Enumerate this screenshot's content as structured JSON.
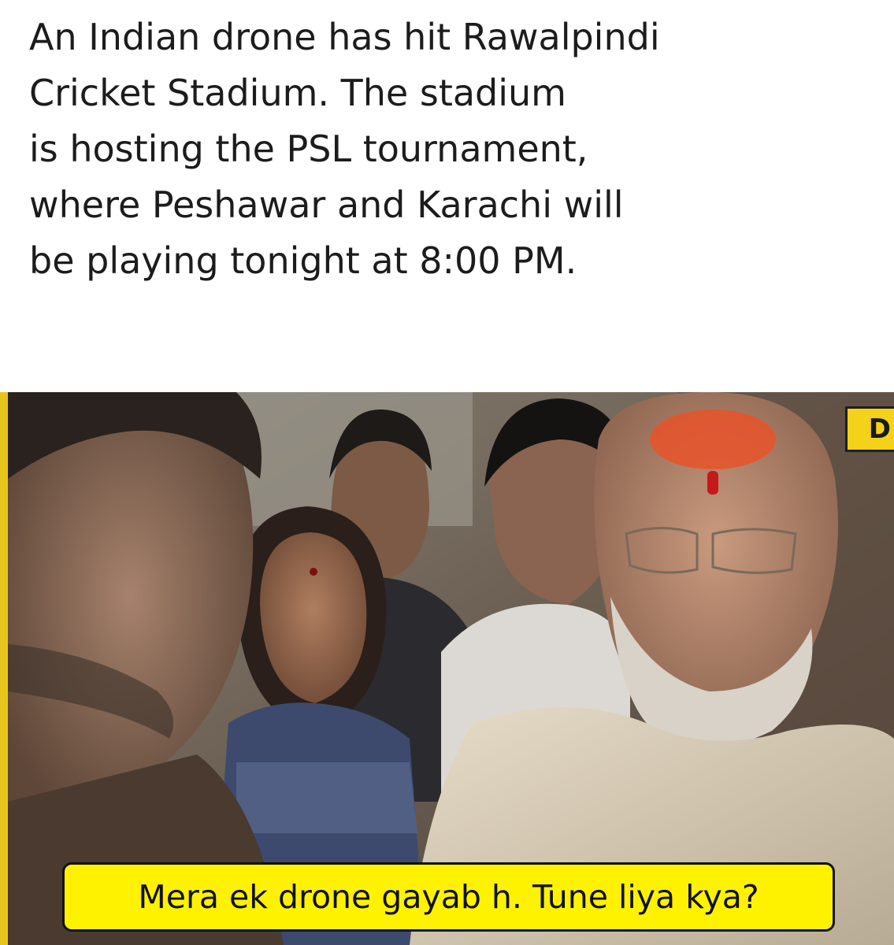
{
  "headline": {
    "lines": [
      "An Indian drone has hit Rawalpindi",
      "Cricket Stadium. The stadium",
      "is hosting the PSL tournament,",
      "where Peshawar and Karachi will",
      "be playing tonight at 8:00 PM."
    ],
    "color": "#1c1c1c"
  },
  "photo": {
    "channel_logo_text": "D",
    "caption": "Mera ek drone gayab h. Tune liya kya?",
    "colors": {
      "caption_background": "#fff200",
      "logo_background": "#f4d21a",
      "tilak": "#e8542a"
    }
  }
}
